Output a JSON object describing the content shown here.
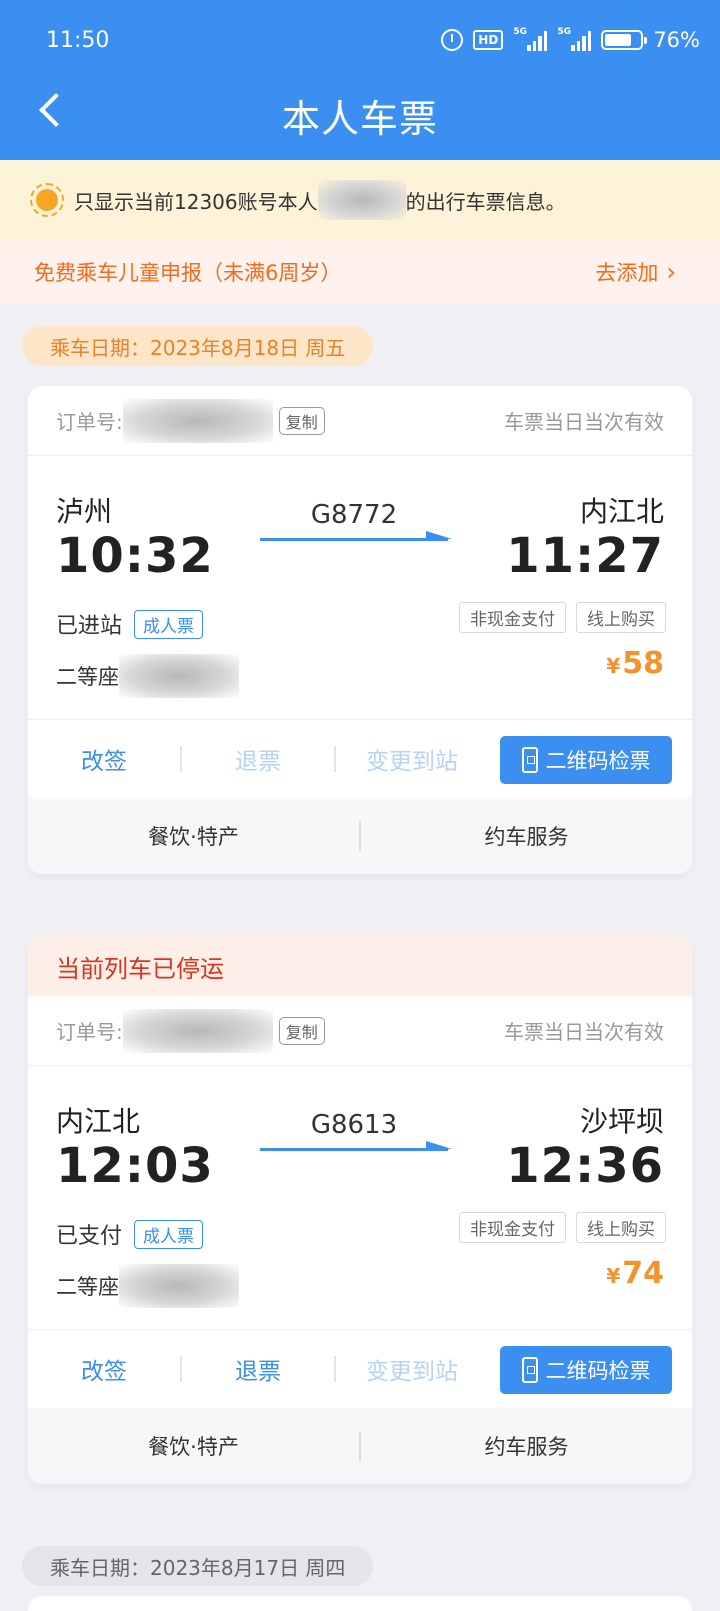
{
  "status_bar": {
    "time": "11:50",
    "battery": "76%",
    "hd_label": "HD",
    "net1": "5G",
    "net2": "5G"
  },
  "header": {
    "title": "本人车票"
  },
  "notice": {
    "prefix": "只显示当前12306账号本人",
    "suffix": "的出行车票信息。"
  },
  "child_report": {
    "label": "免费乘车儿童申报（未满6周岁）",
    "action": "去添加"
  },
  "date_groups": [
    {
      "label": "乘车日期：2023年8月18日 周五"
    },
    {
      "label": "乘车日期：2023年8月17日 周四"
    }
  ],
  "tickets": [
    {
      "banner": "",
      "order_label": "订单号:",
      "copy_label": "复制",
      "validity": "车票当日当次有效",
      "from_station": "泸州",
      "from_time": "10:32",
      "train_no": "G8772",
      "to_station": "内江北",
      "to_time": "11:27",
      "status": "已进站",
      "ticket_type": "成人票",
      "seat_class": "二等座",
      "tags": [
        "非现金支付",
        "线上购买"
      ],
      "currency": "¥",
      "price": "58",
      "actions": {
        "change": "改签",
        "refund": "退票",
        "change_station": "变更到站",
        "qr": "二维码检票"
      },
      "refund_enabled": false,
      "services": [
        "餐饮·特产",
        "约车服务"
      ]
    },
    {
      "banner": "当前列车已停运",
      "order_label": "订单号:",
      "copy_label": "复制",
      "validity": "车票当日当次有效",
      "from_station": "内江北",
      "from_time": "12:03",
      "train_no": "G8613",
      "to_station": "沙坪坝",
      "to_time": "12:36",
      "status": "已支付",
      "ticket_type": "成人票",
      "seat_class": "二等座",
      "tags": [
        "非现金支付",
        "线上购买"
      ],
      "currency": "¥",
      "price": "74",
      "actions": {
        "change": "改签",
        "refund": "退票",
        "change_station": "变更到站",
        "qr": "二维码检票"
      },
      "refund_enabled": true,
      "services": [
        "餐饮·特产",
        "约车服务"
      ]
    }
  ],
  "colors": {
    "primary": "#3b8ff0",
    "price": "#f5922b",
    "alert": "#d6371f",
    "warning_bg": "#fdf3d8"
  }
}
